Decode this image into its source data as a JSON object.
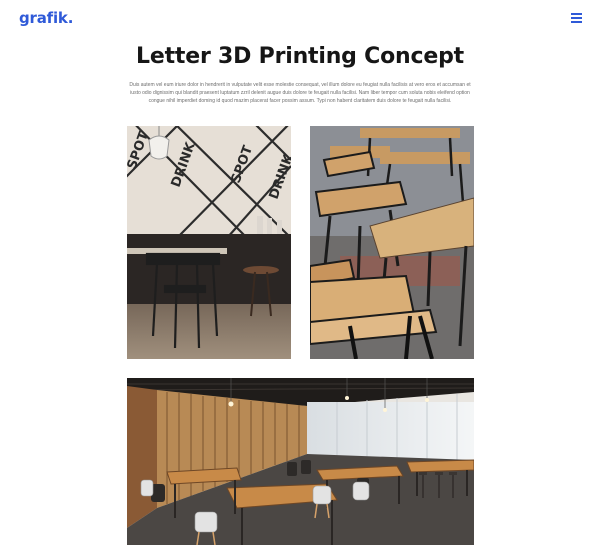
{
  "header": {
    "logo": "grafik.",
    "menu_icon": "hamburger-menu-icon"
  },
  "article": {
    "title": "Letter 3D Printing Concept",
    "description": "Duis autem vel eum iriure dolor in hendrerit in vulputate velit esse molestie consequat, vel illum dolore eu feugiat nulla facilisis at vero eros et accumsan et iusto odio dignissim qui blandit praesent luptatum zzril delenit augue duis dolore te feugait nulla facilisi. Nam liber tempor cum soluta nobis eleifend option congue nihil imperdiet doming id quod mazim placerat facer possim assum. Typi non habent claritatem duis dolore te feugait nulla facilisi."
  },
  "gallery": {
    "images": [
      {
        "subject": "cafe-wall-with-crossed-lettering-and-stools"
      },
      {
        "subject": "wooden-chairs-and-tables-closeup"
      },
      {
        "subject": "restaurant-interior-wide-view"
      }
    ],
    "wall_lettering": [
      "SPOT",
      "DRINK",
      "SPOT",
      "DRINK"
    ]
  },
  "colors": {
    "brand": "#2f5ad8",
    "title": "#161616",
    "body_text": "#6d6d6d"
  }
}
